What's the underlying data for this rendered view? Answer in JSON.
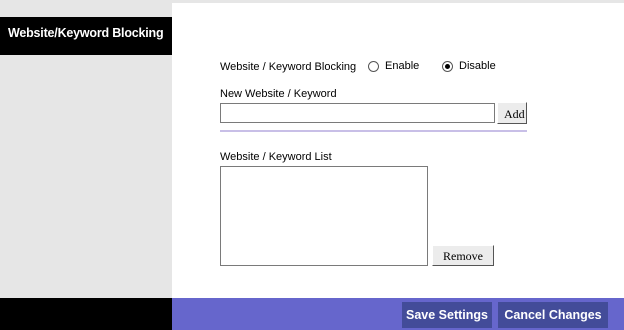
{
  "sidebar": {
    "title": "Website/Keyword Blocking"
  },
  "blocking": {
    "label": "Website / Keyword Blocking",
    "enable_label": "Enable",
    "disable_label": "Disable",
    "selected": "Disable"
  },
  "new_entry": {
    "label": "New Website / Keyword",
    "value": "",
    "add_label": "Add"
  },
  "list": {
    "label": "Website / Keyword List",
    "items": [],
    "remove_label": "Remove"
  },
  "footer": {
    "save_label": "Save Settings",
    "cancel_label": "Cancel Changes"
  }
}
